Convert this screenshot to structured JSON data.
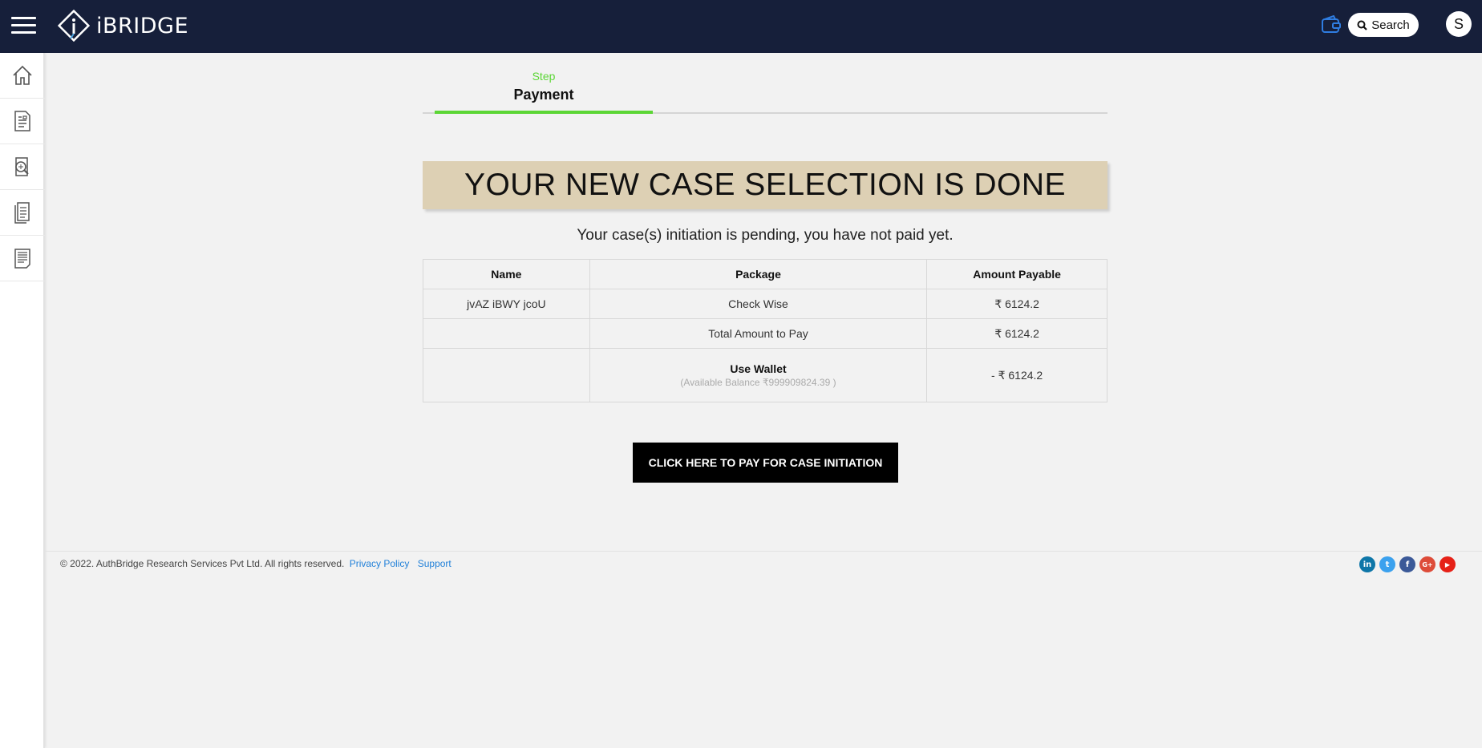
{
  "header": {
    "brand": "iBRIDGE",
    "search_label": "Search",
    "avatar_initial": "S",
    "icons": [
      "menu-icon",
      "wallet-icon",
      "search-icon"
    ]
  },
  "sidebar": {
    "items": [
      {
        "icon": "home-icon"
      },
      {
        "icon": "case-list-icon"
      },
      {
        "icon": "verification-search-icon"
      },
      {
        "icon": "document-icon"
      },
      {
        "icon": "report-icon"
      }
    ]
  },
  "stepper": {
    "step_label": "Step",
    "step_title": "Payment"
  },
  "banner": {
    "heading": "YOUR NEW CASE SELECTION IS DONE",
    "subtitle": "Your case(s) initiation is pending, you have not paid yet."
  },
  "table": {
    "headers": [
      "Name",
      "Package",
      "Amount Payable"
    ],
    "rows": [
      {
        "name": "jvAZ iBWY jcoU",
        "package": "Check Wise",
        "amount": "₹ 6124.2"
      }
    ],
    "total": {
      "label": "Total Amount to Pay",
      "amount": "₹ 6124.2"
    },
    "wallet": {
      "label": "Use Wallet",
      "balance": "(Available Balance ₹999909824.39 )",
      "amount": "- ₹ 6124.2"
    }
  },
  "pay_button": "CLICK HERE TO PAY FOR CASE INITIATION",
  "footer": {
    "copyright": "© 2022. AuthBridge Research Services Pvt Ltd. All rights reserved.",
    "privacy": "Privacy Policy",
    "support": "Support",
    "socials": [
      {
        "icon": "linkedin-icon",
        "glyph": "in",
        "color": "#0e76a8"
      },
      {
        "icon": "twitter-icon",
        "glyph": "t",
        "color": "#3ba1ee"
      },
      {
        "icon": "facebook-icon",
        "glyph": "f",
        "color": "#3b5998"
      },
      {
        "icon": "google-plus-icon",
        "glyph": "G+",
        "color": "#dd4b39"
      },
      {
        "icon": "youtube-icon",
        "glyph": "▶",
        "color": "#e62117"
      }
    ]
  },
  "colors": {
    "topbar": "#161f3a",
    "accent_green": "#5cd636",
    "banner": "#ddd0b4",
    "link_blue": "#1f8ad8"
  }
}
